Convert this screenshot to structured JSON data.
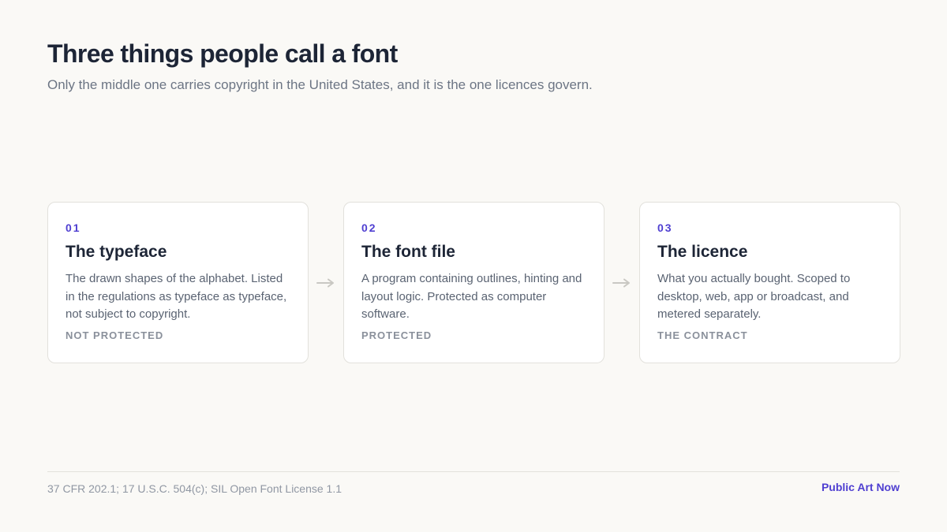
{
  "title": "Three things people call a font",
  "subtitle": "Only the middle one carries copyright in the United States, and it is the one licences govern.",
  "cards": [
    {
      "number": "01",
      "title": "The typeface",
      "description": "The drawn shapes of the alphabet. Listed in the regulations as typeface as typeface, not subject to copyright.",
      "status": "NOT PROTECTED"
    },
    {
      "number": "02",
      "title": "The font file",
      "description": "A program containing outlines, hinting and layout logic. Protected as computer software.",
      "status": "PROTECTED"
    },
    {
      "number": "03",
      "title": "The licence",
      "description": "What you actually bought. Scoped to desktop, web, app or broadcast, and metered separately.",
      "status": "THE CONTRACT"
    }
  ],
  "connector_icon": "arrow-right-icon",
  "footer": {
    "source": "37 CFR 202.1; 17 U.S.C. 504(c); SIL Open Font License 1.1",
    "brand": "Public Art Now"
  },
  "colors": {
    "accent": "#4f3fd1",
    "heading": "#1d2536",
    "muted": "#8a909b",
    "background": "#faf9f6",
    "card_border": "#e2e1dc"
  }
}
